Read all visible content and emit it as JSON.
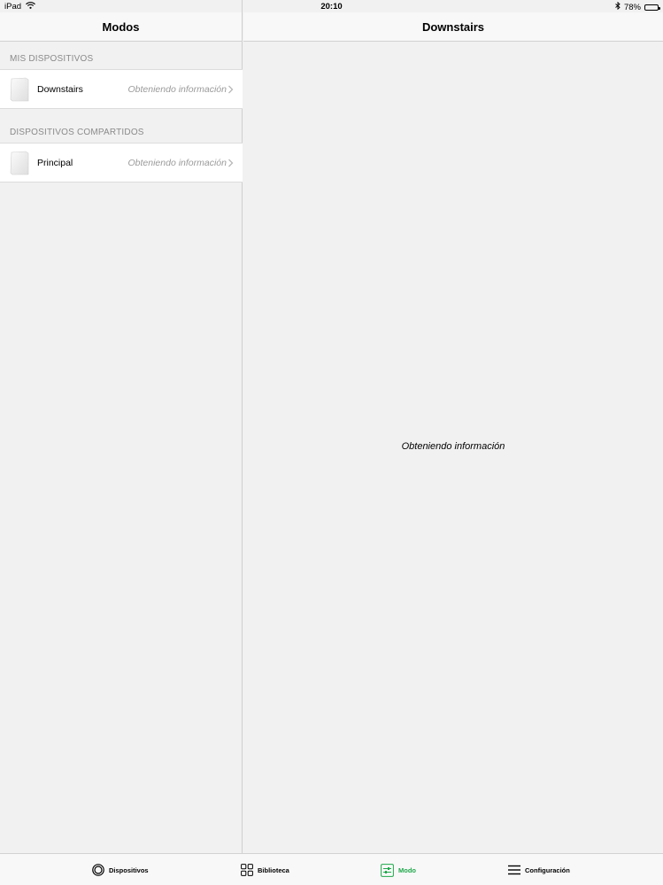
{
  "status_bar": {
    "device": "iPad",
    "time": "20:10",
    "battery": "78%",
    "battery_level": 0.78
  },
  "master": {
    "title": "Modos",
    "sections": [
      {
        "header": "MIS DISPOSITIVOS",
        "rows": [
          {
            "name": "Downstairs",
            "status": "Obteniendo información"
          }
        ]
      },
      {
        "header": "DISPOSITIVOS COMPARTIDOS",
        "rows": [
          {
            "name": "Principal",
            "status": "Obteniendo información"
          }
        ]
      }
    ]
  },
  "detail": {
    "title": "Downstairs",
    "loading_text": "Obteniendo información"
  },
  "tabs": [
    {
      "label": "Dispositivos",
      "icon": "devices-icon",
      "active": false
    },
    {
      "label": "Biblioteca",
      "icon": "library-grid-icon",
      "active": false
    },
    {
      "label": "Modo",
      "icon": "mode-sliders-icon",
      "active": true
    },
    {
      "label": "Configuración",
      "icon": "menu-icon",
      "active": false
    }
  ],
  "colors": {
    "accent": "#1ea84a",
    "background": "#f1f1f1",
    "bar": "#f8f8f8"
  }
}
